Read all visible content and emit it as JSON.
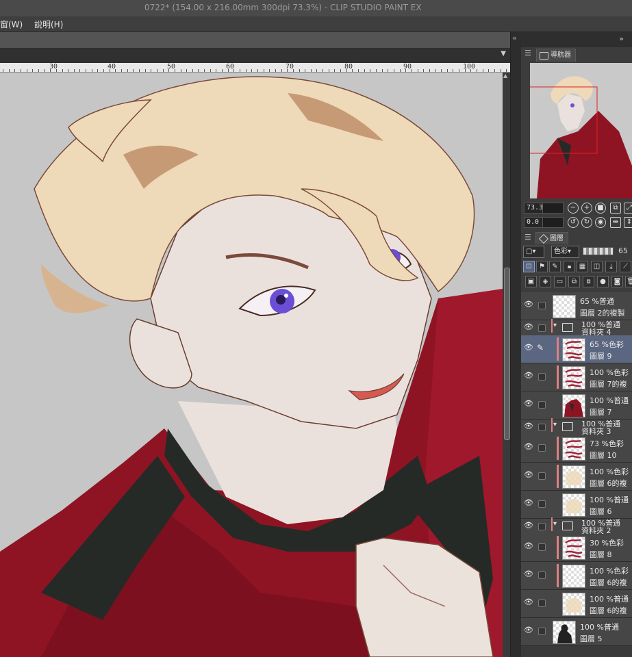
{
  "window": {
    "title": "0722* (154.00 x 216.00mm 300dpi 73.3%)  - CLIP STUDIO PAINT EX"
  },
  "menu": {
    "items": [
      "窗(W)",
      "說明(H)"
    ]
  },
  "ruler": {
    "labels": [
      "30",
      "40",
      "50",
      "60",
      "70",
      "80",
      "90",
      "100"
    ]
  },
  "navigator": {
    "tab_label": "導航器",
    "zoom_value": "73.3",
    "rotate_value": "0.0"
  },
  "layer_panel": {
    "tab_label": "圖層",
    "blend_mode": "色彩",
    "opacity_value": "65",
    "layers": [
      {
        "type": "layer",
        "line1": "65 %普通",
        "line2": "圖層 2的複製",
        "clip": false,
        "selected": false,
        "editing": false,
        "thumb": "blank"
      },
      {
        "type": "folder",
        "line1": "100 %普通",
        "line2": "資料夾 4"
      },
      {
        "type": "layer",
        "line1": "65 %色彩",
        "line2": "圖層 9",
        "clip": true,
        "selected": true,
        "editing": true,
        "thumb": "red-strokes"
      },
      {
        "type": "layer",
        "line1": "100 %色彩",
        "line2": "圖層 7的複",
        "clip": true,
        "selected": false,
        "editing": false,
        "thumb": "red-strokes"
      },
      {
        "type": "layer",
        "line1": "100 %普通",
        "line2": "圖層 7",
        "clip": false,
        "selected": false,
        "editing": false,
        "thumb": "red-figure"
      },
      {
        "type": "folder",
        "line1": "100 %普通",
        "line2": "資料夾 3"
      },
      {
        "type": "layer",
        "line1": "73 %色彩",
        "line2": "圖層 10",
        "clip": true,
        "selected": false,
        "editing": false,
        "thumb": "red-strokes"
      },
      {
        "type": "layer",
        "line1": "100 %色彩",
        "line2": "圖層 6的複",
        "clip": true,
        "selected": false,
        "editing": false,
        "thumb": "beige"
      },
      {
        "type": "layer",
        "line1": "100 %普通",
        "line2": "圖層 6",
        "clip": false,
        "selected": false,
        "editing": false,
        "thumb": "beige"
      },
      {
        "type": "folder",
        "line1": "100 %普通",
        "line2": "資料夾 2"
      },
      {
        "type": "layer",
        "line1": "30 %色彩",
        "line2": "圖層 8",
        "clip": true,
        "selected": false,
        "editing": false,
        "thumb": "red-strokes"
      },
      {
        "type": "layer",
        "line1": "100 %色彩",
        "line2": "圖層 6的複",
        "clip": true,
        "selected": false,
        "editing": false,
        "thumb": "blank"
      },
      {
        "type": "layer",
        "line1": "100 %普通",
        "line2": "圖層 6的複",
        "clip": false,
        "selected": false,
        "editing": false,
        "thumb": "beige"
      },
      {
        "type": "layer",
        "line1": "100 %普通",
        "line2": "圖層 5",
        "clip": false,
        "selected": false,
        "editing": false,
        "thumb": "silhouette"
      }
    ]
  },
  "colors": {
    "hair": "#eed9b8",
    "skin": "#ebe1dc",
    "jacket": "#8e1424",
    "collar": "#262a26",
    "eye": "#6a4fd6",
    "canvas_bg": "#c6c6c6",
    "selection": "#5b6780",
    "clip_marker": "#e08080"
  },
  "icons": [
    "eye-icon",
    "pen-icon",
    "folder-icon",
    "layers-icon",
    "navigator-icon",
    "zoom-in-icon",
    "zoom-out-icon",
    "rotate-icon",
    "flip-icon",
    "lock-icon",
    "new-layer-icon",
    "trash-icon"
  ]
}
